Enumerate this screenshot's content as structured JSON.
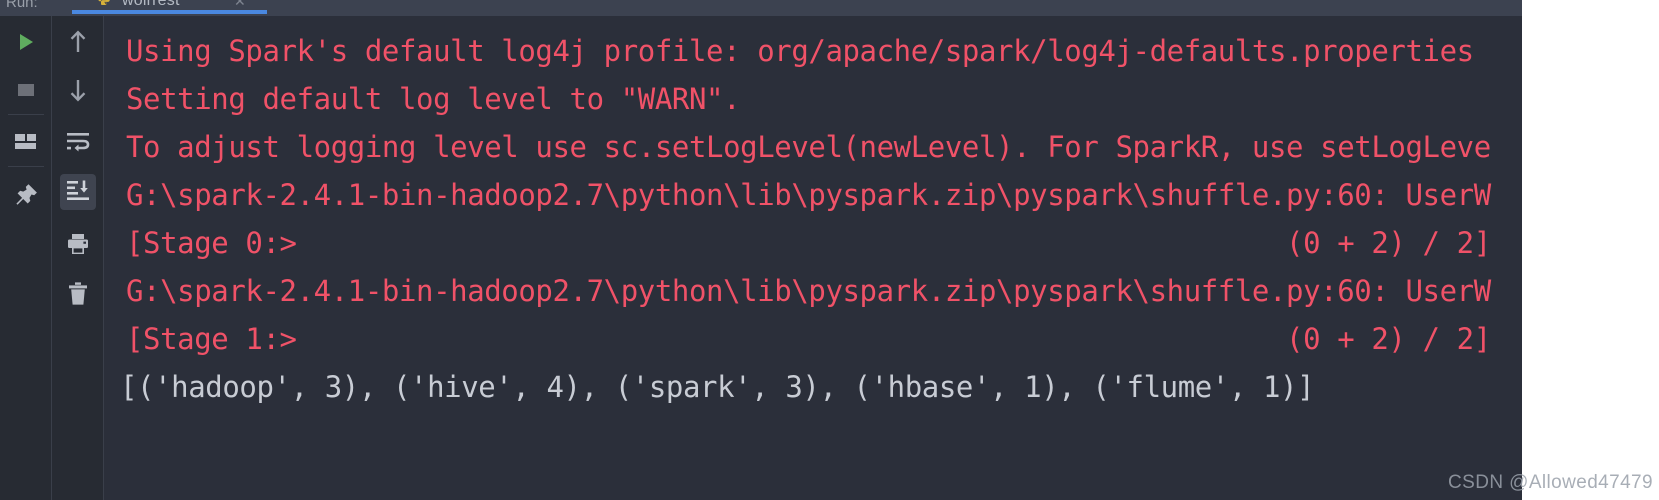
{
  "window": {
    "tool_label": "Run:",
    "accent_color": "#4a88e0",
    "background_color": "#2b2f3a",
    "toolbar_color": "#272b33",
    "header_color": "#3c4250"
  },
  "tab": {
    "label": "wolrrest",
    "icon": "python-file-icon",
    "close_glyph": "✕"
  },
  "toolbar_primary": [
    {
      "name": "rerun-button",
      "icon": "play-icon",
      "glyph": "▶",
      "color": "#5fad5f",
      "active": false
    },
    {
      "name": "stop-button",
      "icon": "stop-square-icon",
      "glyph": "■",
      "color": "#6d7078",
      "active": false
    },
    {
      "name": "layout-button",
      "icon": "layout-windows-icon",
      "glyph": "",
      "color": "#b8bcc4",
      "active": false
    },
    {
      "name": "pin-tab-button",
      "icon": "pin-icon",
      "glyph": "",
      "color": "#b8bcc4",
      "active": false
    }
  ],
  "toolbar_secondary": [
    {
      "name": "up-the-stack-trace-button",
      "icon": "arrow-up-icon",
      "active": false
    },
    {
      "name": "down-the-stack-trace-button",
      "icon": "arrow-down-icon",
      "active": false
    },
    {
      "name": "soft-wrap-button",
      "icon": "soft-wrap-icon",
      "active": false
    },
    {
      "name": "scroll-to-end-button",
      "icon": "scroll-to-end-icon",
      "active": true
    },
    {
      "name": "print-button",
      "icon": "printer-icon",
      "active": false
    },
    {
      "name": "clear-all-button",
      "icon": "trash-icon",
      "active": false
    }
  ],
  "console": {
    "stderr_color": "#f05268",
    "stdout_color": "#c8ccd4",
    "lines": [
      {
        "stream": "stderr",
        "text": "Using Spark's default log4j profile: org/apache/spark/log4j-defaults.properties"
      },
      {
        "stream": "stderr",
        "text": "Setting default log level to \"WARN\"."
      },
      {
        "stream": "stderr",
        "text": "To adjust logging level use sc.setLogLevel(newLevel). For SparkR, use setLogLeve"
      },
      {
        "stream": "stderr",
        "text": "G:\\spark-2.4.1-bin-hadoop2.7\\python\\lib\\pyspark.zip\\pyspark\\shuffle.py:60: UserW"
      },
      {
        "stream": "stderr",
        "text": "[Stage 0:>                                                          (0 + 2) / 2]"
      },
      {
        "stream": "stderr",
        "text": "G:\\spark-2.4.1-bin-hadoop2.7\\python\\lib\\pyspark.zip\\pyspark\\shuffle.py:60: UserW"
      },
      {
        "stream": "stderr",
        "text": "[Stage 1:>                                                          (0 + 2) / 2]"
      },
      {
        "stream": "stdout",
        "text": "[('hadoop', 3), ('hive', 4), ('spark', 3), ('hbase', 1), ('flume', 1)]"
      }
    ]
  },
  "watermark": {
    "text": "CSDN @Allowed47479"
  }
}
